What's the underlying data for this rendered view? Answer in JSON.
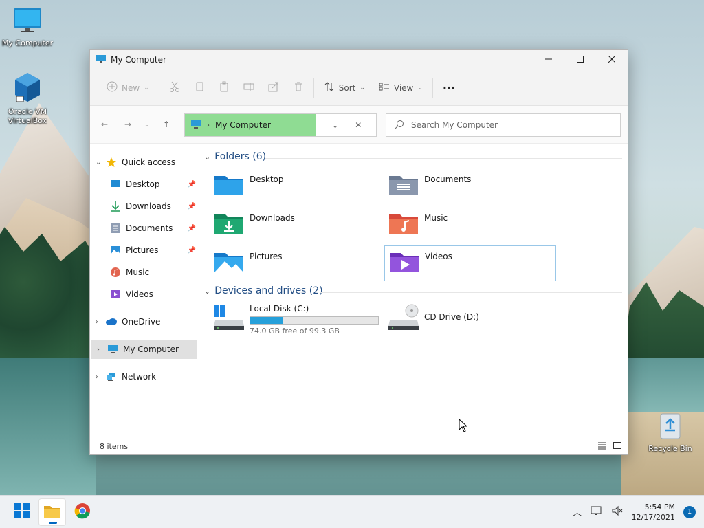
{
  "desktop": {
    "icons": [
      {
        "label": "My Computer",
        "icon": "monitor-icon"
      },
      {
        "label": "Oracle VM VirtualBox",
        "icon": "virtualbox-icon"
      },
      {
        "label": "Recycle Bin",
        "icon": "recycle-bin-icon"
      }
    ]
  },
  "window": {
    "title": "My Computer",
    "controls": {
      "minimize": "minimize-icon",
      "maximize": "maximize-icon",
      "close": "close-icon"
    }
  },
  "toolbar": {
    "new_label": "New",
    "sort_label": "Sort",
    "view_label": "View",
    "more_label": "···"
  },
  "address": {
    "path": "My Computer",
    "search_placeholder": "Search My Computer"
  },
  "nav": {
    "quick_access": "Quick access",
    "items": [
      {
        "label": "Desktop",
        "icon": "desktop-icon",
        "pinned": true
      },
      {
        "label": "Downloads",
        "icon": "download-icon",
        "pinned": true
      },
      {
        "label": "Documents",
        "icon": "document-icon",
        "pinned": true
      },
      {
        "label": "Pictures",
        "icon": "picture-icon",
        "pinned": true
      },
      {
        "label": "Music",
        "icon": "music-icon",
        "pinned": false
      },
      {
        "label": "Videos",
        "icon": "video-icon",
        "pinned": false
      }
    ],
    "onedrive": "OneDrive",
    "mycomputer": "My Computer",
    "network": "Network"
  },
  "content": {
    "folders_header": "Folders (6)",
    "folders": [
      {
        "name": "Desktop",
        "icon": "desktop-folder-icon"
      },
      {
        "name": "Documents",
        "icon": "documents-folder-icon"
      },
      {
        "name": "Downloads",
        "icon": "downloads-folder-icon"
      },
      {
        "name": "Music",
        "icon": "music-folder-icon"
      },
      {
        "name": "Pictures",
        "icon": "pictures-folder-icon"
      },
      {
        "name": "Videos",
        "icon": "videos-folder-icon"
      }
    ],
    "drives_header": "Devices and drives (2)",
    "drives": [
      {
        "name": "Local Disk (C:)",
        "free_text": "74.0 GB free of 99.3 GB",
        "used_fraction": 0.255
      },
      {
        "name": "CD Drive (D:)"
      }
    ]
  },
  "status": {
    "items": "8 items"
  },
  "taskbar": {
    "time": "5:54 PM",
    "date": "12/17/2021",
    "notification_count": "1"
  },
  "colors": {
    "accent": "#0067c0",
    "address_highlight": "#8fdc93",
    "disk_bar": "#26a0da",
    "group_header": "#244f85"
  }
}
